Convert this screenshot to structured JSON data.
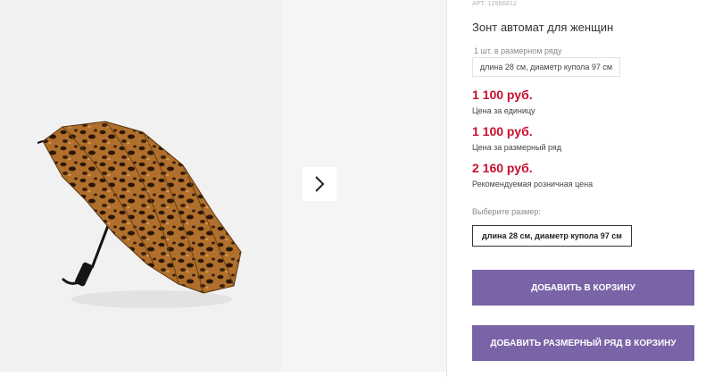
{
  "product": {
    "article": "АРТ. 12566812",
    "title": "Зонт автомат для женщин",
    "size_row_label": "1 шт. в размерном ряду",
    "size_row_value": "длина 28 см, диаметр купола 97 см"
  },
  "prices": [
    {
      "value": "1 100 руб.",
      "caption": "Цена за единицу"
    },
    {
      "value": "1 100 руб.",
      "caption": "Цена за размерный ряд"
    },
    {
      "value": "2 160 руб.",
      "caption": "Рекомендуемая розничная цена"
    }
  ],
  "size_select": {
    "prompt": "Выберите размер:",
    "option": "длина 28 см, диаметр купола 97 см"
  },
  "buttons": {
    "add_to_cart": "ДОБАВИТЬ В КОРЗИНУ",
    "add_size_row": "ДОБАВИТЬ РАЗМЕРНЫЙ РЯД В КОРЗИНУ"
  },
  "gallery": {
    "main_image": "leopard-print-umbrella-photo",
    "next_icon": "chevron-right-icon"
  },
  "colors": {
    "price": "#c8102e",
    "button": "#7a63a6",
    "photo_bg": "#f1f1f1"
  }
}
